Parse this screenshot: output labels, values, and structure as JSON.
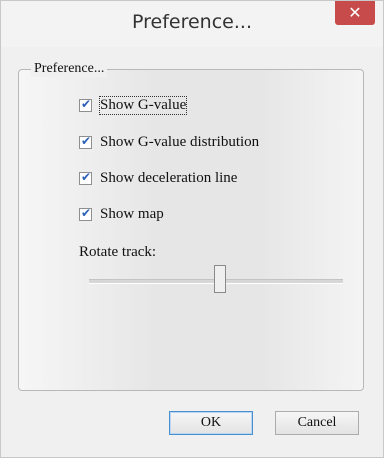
{
  "window": {
    "title": "Preference...",
    "close_glyph": "✕"
  },
  "panel": {
    "legend": "Preference...",
    "options": [
      {
        "label": "Show G-value",
        "checked": true
      },
      {
        "label": "Show G-value distribution",
        "checked": true
      },
      {
        "label": "Show deceleration line",
        "checked": true
      },
      {
        "label": "Show map",
        "checked": true
      }
    ],
    "rotate_label": "Rotate track:",
    "rotate_level": 0.5
  },
  "buttons": {
    "ok": "OK",
    "cancel": "Cancel"
  },
  "check_glyph": "✔",
  "colors": {
    "close_bg": "#c74b4b",
    "check": "#2a5fb8"
  }
}
